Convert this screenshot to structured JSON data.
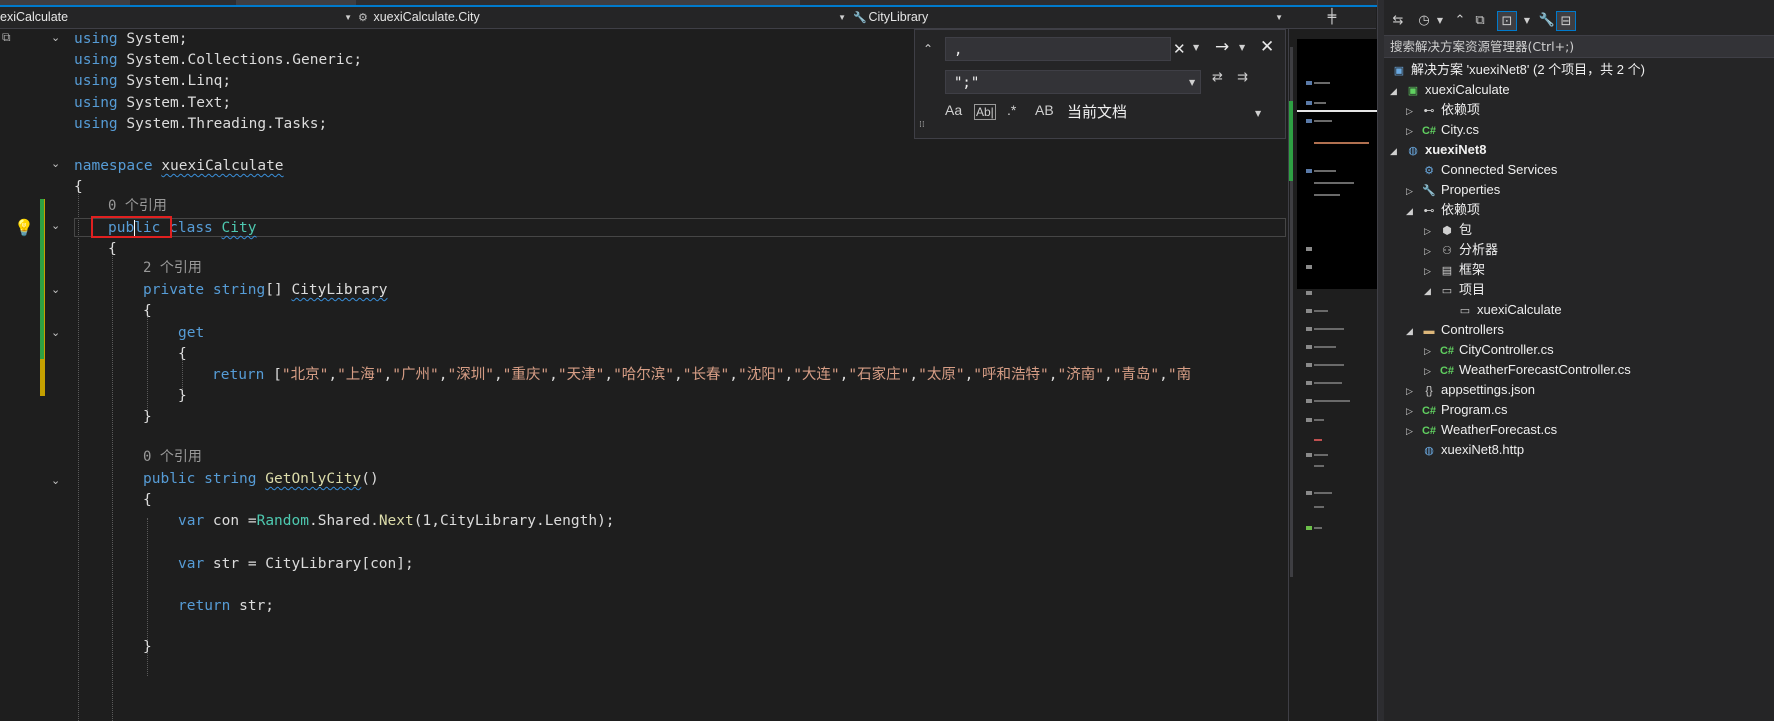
{
  "nav": {
    "project": "exiCalculate",
    "type": "xuexiCalculate.City",
    "member": "CityLibrary",
    "split_icon": "split-editor-icon"
  },
  "code": {
    "l1_kw": "using",
    "l1_ns": " System;",
    "l2_kw": "using",
    "l2_ns": " System.Collections.Generic;",
    "l3_kw": "using",
    "l3_ns": " System.Linq;",
    "l4_kw": "using",
    "l4_ns": " System.Text;",
    "l5_kw": "using",
    "l5_ns": " System.Threading.Tasks;",
    "ns_kw": "namespace",
    "ns_name": "xuexiCalculate",
    "brace_open": "{",
    "brace_close": "}",
    "lens_class": "0 个引用",
    "class_pub_a": "pub",
    "class_pub_b": "lic",
    "class_kw": "class",
    "class_name": "City",
    "lens_prop": "2 个引用",
    "prop_private": "private",
    "prop_type": "string",
    "prop_brackets": "[]",
    "prop_name": "CityLibrary",
    "get_kw": "get",
    "return_kw": "return",
    "return_open": "[",
    "cities": [
      "北京",
      "上海",
      "广州",
      "深圳",
      "重庆",
      "天津",
      "哈尔滨",
      "长春",
      "沈阳",
      "大连",
      "石家庄",
      "太原",
      "呼和浩特",
      "济南",
      "青岛",
      "南"
    ],
    "lens_method": "0 个引用",
    "m_public": "public",
    "m_type": "string",
    "m_name": "GetOnlyCity",
    "m_parens": "()",
    "var_kw": "var",
    "con_a": " con =",
    "random_type": "Random",
    "con_b": ".Shared.",
    "next_fn": "Next",
    "con_c": "(1,CityLibrary.Length);",
    "str_a": " str = CityLibrary[con];",
    "ret_b": " str;"
  },
  "find": {
    "search_value": ",",
    "replace_value": "\";\"",
    "match_case": "Aa",
    "whole_word": "Ab|",
    "regex": ".*",
    "preserve_case": "AB",
    "scope": "当前文档"
  },
  "explorer": {
    "search_placeholder": "搜索解决方案资源管理器(Ctrl+;)",
    "solution": "解决方案 'xuexiNet8' (2 个项目，共 2 个)",
    "items": [
      {
        "label": "xuexiCalculate",
        "icon": "csharp-project-icon"
      },
      {
        "label": "依赖项",
        "icon": "dependencies-icon"
      },
      {
        "label": "City.cs",
        "icon": "csharp-file-icon"
      },
      {
        "label": "xuexiNet8",
        "icon": "web-project-icon"
      },
      {
        "label": "Connected Services",
        "icon": "connected-services-icon"
      },
      {
        "label": "Properties",
        "icon": "properties-icon"
      },
      {
        "label": "依赖项",
        "icon": "dependencies-icon"
      },
      {
        "label": "包",
        "icon": "package-icon"
      },
      {
        "label": "分析器",
        "icon": "analyzer-icon"
      },
      {
        "label": "框架",
        "icon": "framework-icon"
      },
      {
        "label": "项目",
        "icon": "projects-icon"
      },
      {
        "label": "xuexiCalculate",
        "icon": "project-reference-icon"
      },
      {
        "label": "Controllers",
        "icon": "folder-icon"
      },
      {
        "label": "CityController.cs",
        "icon": "csharp-file-icon"
      },
      {
        "label": "WeatherForecastController.cs",
        "icon": "csharp-file-icon"
      },
      {
        "label": "appsettings.json",
        "icon": "json-file-icon"
      },
      {
        "label": "Program.cs",
        "icon": "csharp-file-icon"
      },
      {
        "label": "WeatherForecast.cs",
        "icon": "csharp-file-icon"
      },
      {
        "label": "xuexiNet8.http",
        "icon": "http-file-icon"
      }
    ]
  }
}
